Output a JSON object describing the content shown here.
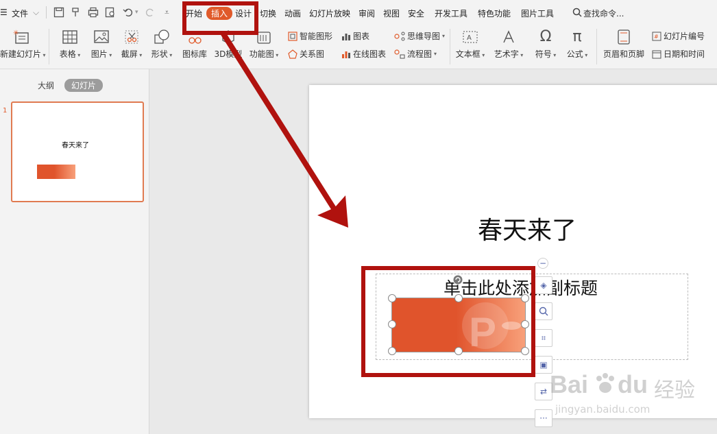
{
  "menubar": {
    "menu_label": "文件",
    "tabs": [
      "开始",
      "插入",
      "设计",
      "切换",
      "动画",
      "幻灯片放映",
      "审阅",
      "视图",
      "安全",
      "开发工具",
      "特色功能",
      "图片工具"
    ],
    "active_tab": "插入",
    "search_label": "查找命令..."
  },
  "ribbon": {
    "new_slide": "新建幻灯片",
    "table": "表格",
    "picture": "图片",
    "screenshot": "截屏",
    "shape": "形状",
    "icon_lib": "图标库",
    "model3d": "3D模型",
    "function_chart": "功能图",
    "smart_art": "智能图形",
    "relation_chart": "关系图",
    "chart": "图表",
    "online_chart": "在线图表",
    "mindmap": "思维导图",
    "flowchart": "流程图",
    "textbox": "文本框",
    "wordart": "艺术字",
    "symbol": "符号",
    "formula": "公式",
    "header_footer": "页眉和页脚",
    "slide_number": "幻灯片编号",
    "date_time": "日期和时间"
  },
  "leftpane": {
    "tab_outline": "大纲",
    "tab_slides": "幻灯片",
    "slide_index": "1",
    "thumb_title": "春天来了"
  },
  "slide": {
    "title": "春天来了",
    "subtitle_placeholder": "单击此处添加副标题"
  },
  "watermark": {
    "brand": "Bai",
    "brand2": "du",
    "suffix": "经验",
    "url": "jingyan.baidu.com"
  },
  "colors": {
    "accent": "#e05a2a",
    "annotation_red": "#b0120e",
    "image_gradient_start": "#e0542c",
    "image_gradient_end": "#f8a07a"
  }
}
